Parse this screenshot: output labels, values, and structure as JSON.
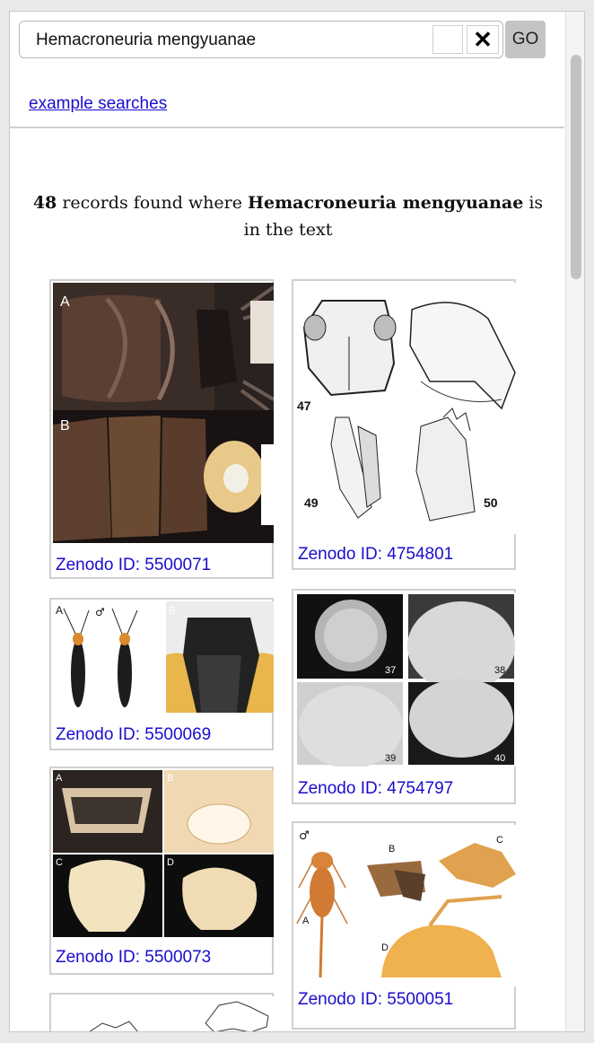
{
  "search": {
    "value": "Hemacroneuria mengyuanae",
    "clear_label": "✕",
    "go_label": "GO"
  },
  "example_link": "example searches",
  "results": {
    "count": "48",
    "text_mid": " records found where ",
    "term": "Hemacroneuria mengyuanae",
    "text_end": " is in the text"
  },
  "cards": [
    {
      "label": "Zenodo ID: ",
      "id": "5500071",
      "figure_letters": [
        "A",
        "B"
      ]
    },
    {
      "label": "Zenodo ID: ",
      "id": "4754801",
      "figure_letters": [
        "47",
        "49",
        "50"
      ]
    },
    {
      "label": "Zenodo ID: ",
      "id": "5500069",
      "figure_letters": [
        "A",
        "♂",
        "B"
      ]
    },
    {
      "label": "Zenodo ID: ",
      "id": "4754797",
      "figure_letters": [
        "37",
        "38",
        "39",
        "40"
      ]
    },
    {
      "label": "Zenodo ID: ",
      "id": "5500073",
      "figure_letters": [
        "A",
        "B",
        "C",
        "D"
      ]
    },
    {
      "label": "Zenodo ID: ",
      "id": "5500051",
      "figure_letters": [
        "♂",
        "B",
        "C",
        "A",
        "D"
      ]
    }
  ],
  "colors": {
    "link": "#1a0dcc",
    "go_button_bg": "#c4c4c4",
    "border": "#cfcfcf"
  }
}
